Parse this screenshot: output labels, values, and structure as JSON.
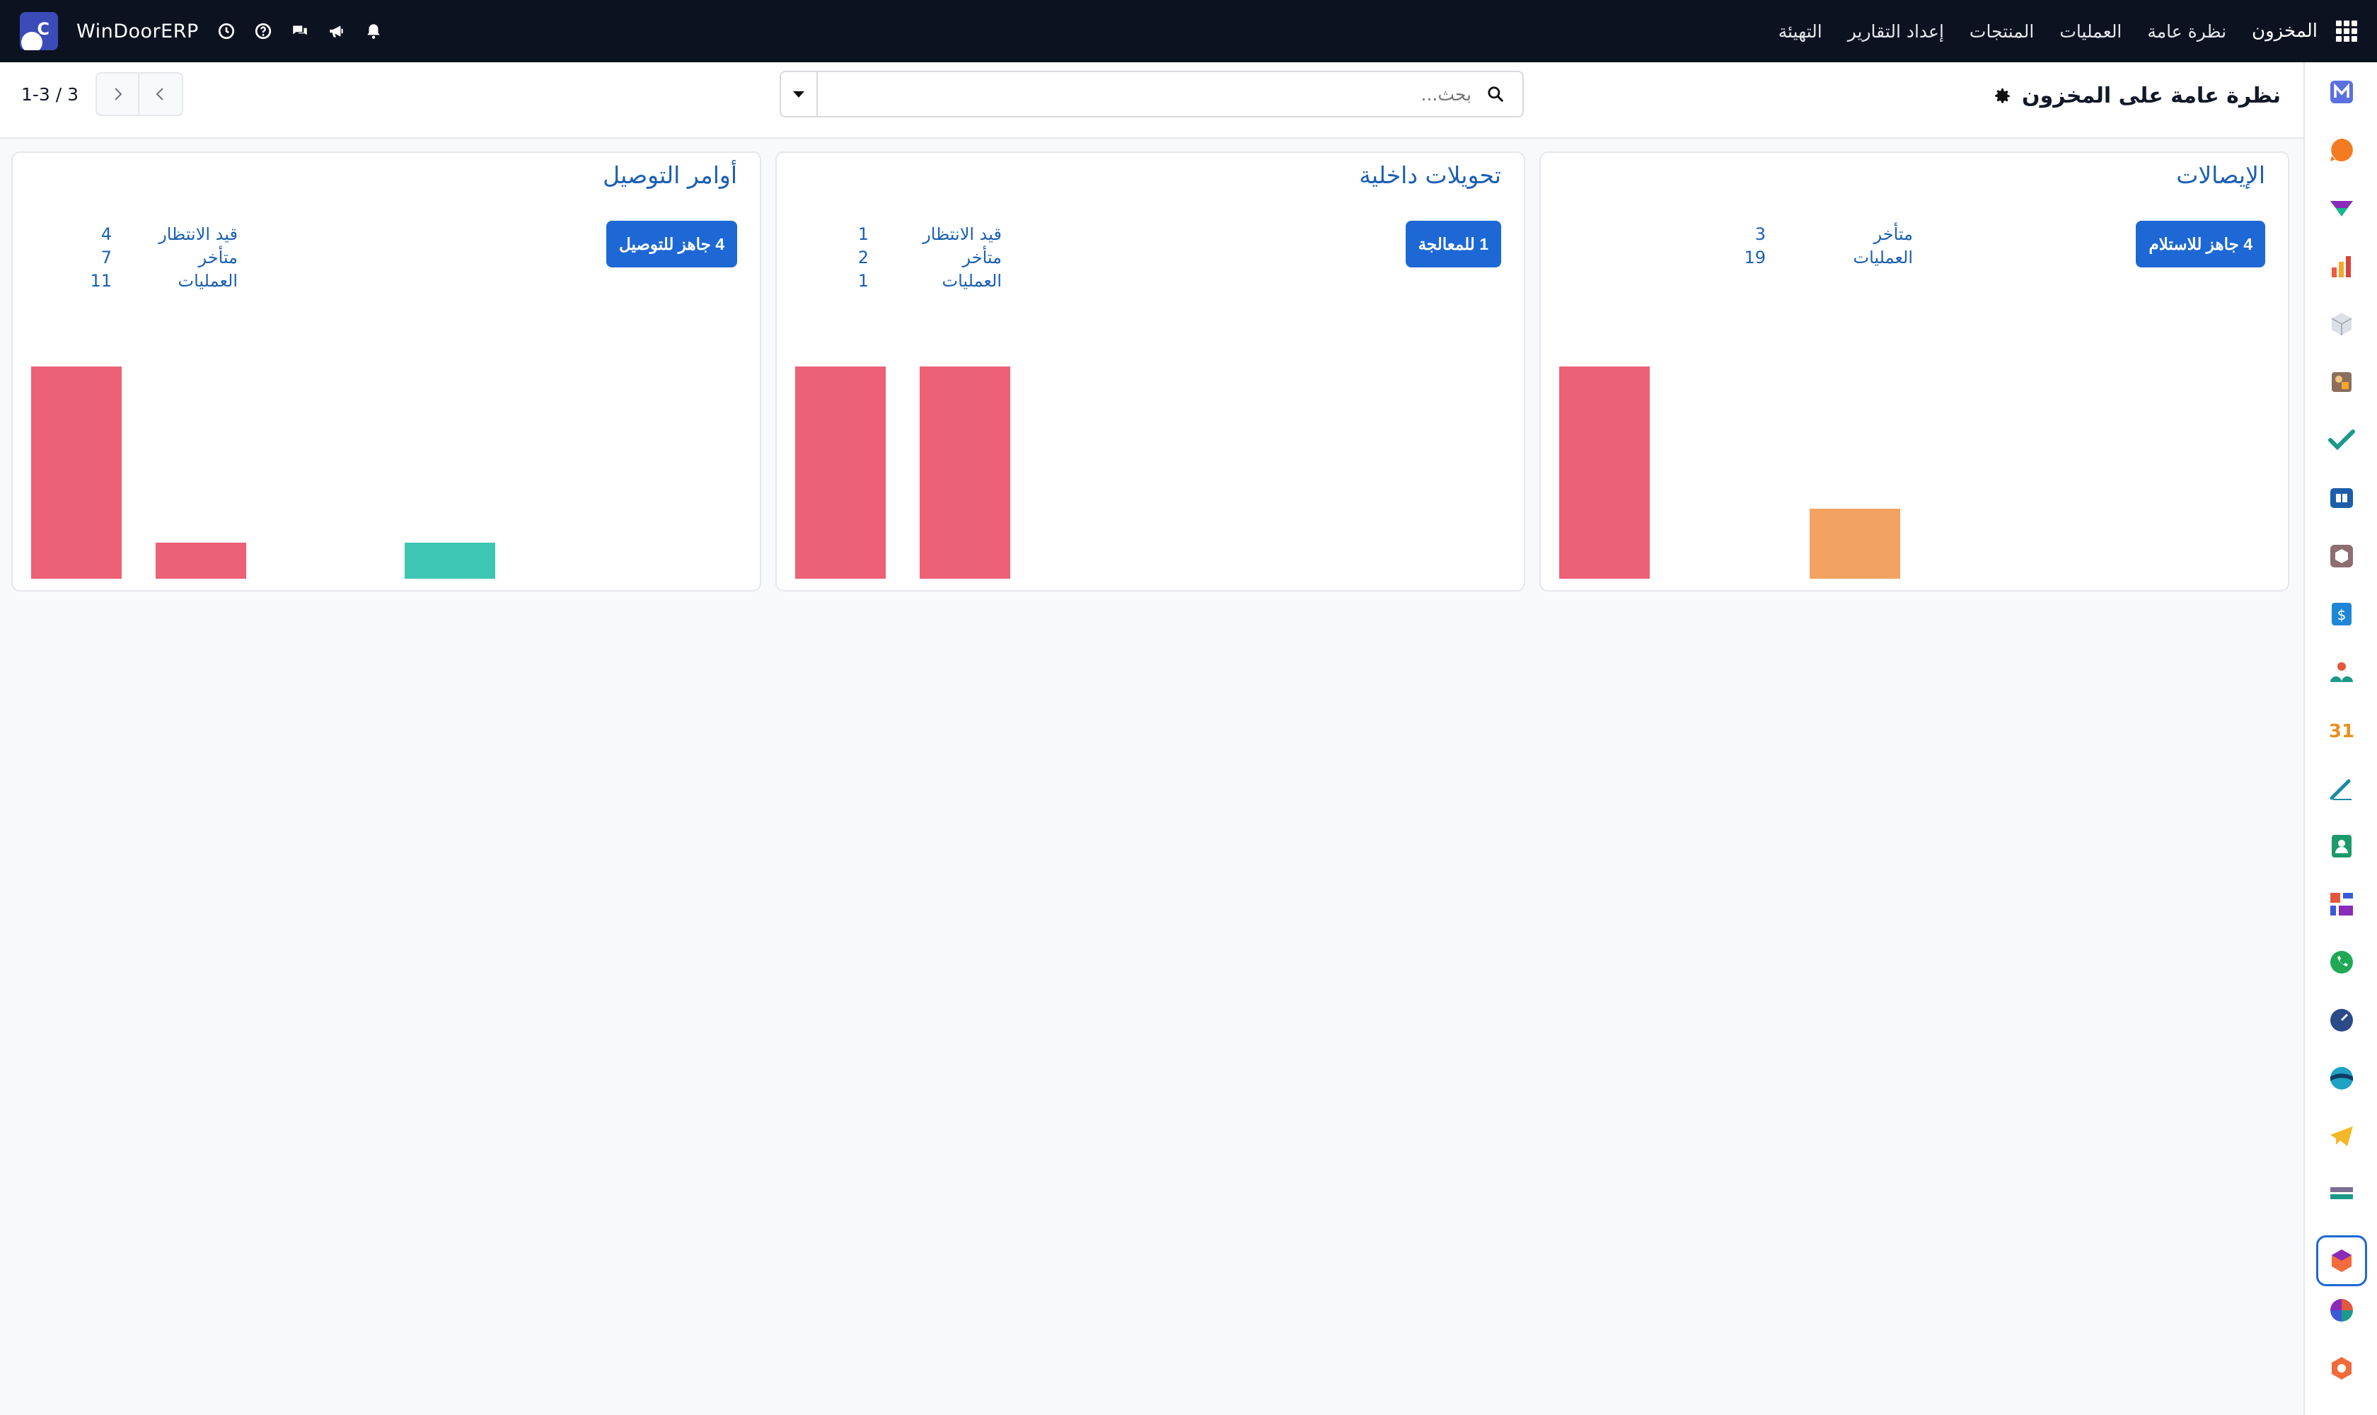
{
  "navbar": {
    "app_name": "المخزون",
    "menu": [
      {
        "label": "نظرة عامة"
      },
      {
        "label": "العمليات"
      },
      {
        "label": "المنتجات"
      },
      {
        "label": "إعداد التقارير"
      },
      {
        "label": "التهيئة"
      }
    ],
    "company": {
      "name": "WinDoorERP",
      "logo_letter": "C"
    },
    "tray_icons": [
      "clock-icon",
      "help-icon",
      "chat-icon",
      "megaphone-icon",
      "bell-icon"
    ]
  },
  "control_panel": {
    "title": "نظرة عامة على المخزون",
    "search_placeholder": "بحث...",
    "pager": "1-3 / 3"
  },
  "cards": [
    {
      "title": "الإيصالات",
      "button": "4 جاهز للاستلام",
      "stats": [
        {
          "label": "متأخر",
          "value": "3"
        },
        {
          "label": "العمليات",
          "value": "19"
        }
      ],
      "bars": [
        {
          "color": "#ec6175",
          "value": 1.0
        },
        {
          "color": "#f4a261",
          "value": 0.33
        }
      ]
    },
    {
      "title": "تحويلات داخلية",
      "button": "1 للمعالجة",
      "stats": [
        {
          "label": "قيد الانتظار",
          "value": "1"
        },
        {
          "label": "متأخر",
          "value": "2"
        },
        {
          "label": "العمليات",
          "value": "1"
        }
      ],
      "bars": [
        {
          "color": "#ec6175",
          "value": 1.0
        },
        {
          "color": "#ec6175",
          "value": 1.0
        }
      ]
    },
    {
      "title": "أوامر التوصيل",
      "button": "4 جاهز للتوصيل",
      "stats": [
        {
          "label": "قيد الانتظار",
          "value": "4"
        },
        {
          "label": "متأخر",
          "value": "7"
        },
        {
          "label": "العمليات",
          "value": "11"
        }
      ],
      "bars": [
        {
          "color": "#ec6175",
          "value": 1.0
        },
        {
          "color": "#ec6175",
          "value": 0.17
        },
        {
          "color": "#3ec6b4",
          "value": 0.17
        }
      ]
    }
  ],
  "appbar": {
    "apps": [
      "mail-app-icon",
      "discuss-app-icon",
      "crm-app-icon",
      "sales-app-icon",
      "products-app-icon",
      "inventory-reports-app-icon",
      "tasks-app-icon",
      "knowledge-app-icon",
      "purchase-app-icon",
      "invoicing-app-icon",
      "employees-app-icon",
      "calendar-app-icon",
      "notes-app-icon",
      "contacts-app-icon",
      "dashboards-app-icon",
      "whatsapp-app-icon",
      "timesheet-app-icon",
      "website-app-icon",
      "telegram-app-icon",
      "accounting-app-icon",
      "inventory-app-icon",
      "charts-app-icon",
      "manufacturing-app-icon"
    ],
    "calendar_label": "31"
  }
}
